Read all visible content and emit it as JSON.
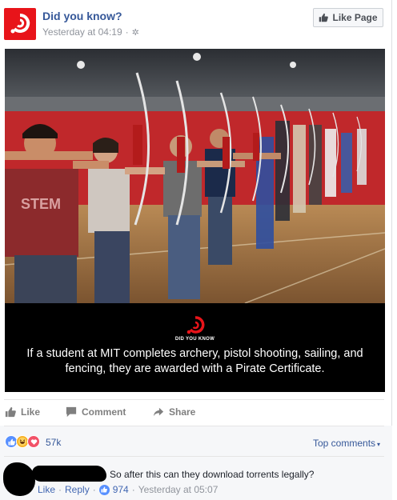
{
  "post": {
    "page_name": "Did you know?",
    "timestamp": "Yesterday at 04:19",
    "separator": "·",
    "like_page_label": "Like Page",
    "logo_text": "DID YOU KNOW",
    "caption": "If a student at MIT completes archery, pistol shooting, sailing, and fencing, they are awarded with a Pirate Certificate.",
    "shirt_text": "STEM"
  },
  "actions": {
    "like_label": "Like",
    "comment_label": "Comment",
    "share_label": "Share"
  },
  "reactions": {
    "count": "57k",
    "top_comments_label": "Top comments",
    "icons": [
      "like-icon",
      "haha-icon",
      "love-icon"
    ]
  },
  "comment": {
    "text": "So after this can they download torrents legally?",
    "like_label": "Like",
    "reply_label": "Reply",
    "sep1": "·",
    "sep2": "·",
    "sep3": "·",
    "like_count": "974",
    "timestamp": "Yesterday at 05:07"
  },
  "colors": {
    "brand_red": "#e8141a",
    "link_blue": "#365899",
    "like_blue": "#5890ff"
  }
}
